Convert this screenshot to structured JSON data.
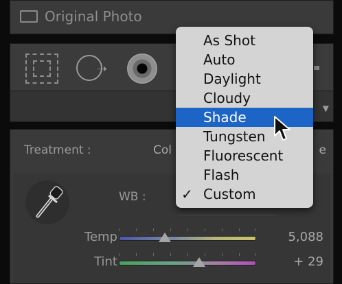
{
  "original_photo": {
    "label": "Original Photo"
  },
  "tools": {
    "icons": [
      "crop-overlay-icon",
      "spot-removal-icon",
      "red-eye-icon"
    ]
  },
  "basic": {
    "treatment_label": "Treatment :",
    "treatment_color": "Col",
    "treatment_bw": "e",
    "wb_label": "WB :",
    "temp": {
      "label": "Temp",
      "value": "5,088",
      "fraction": 0.34
    },
    "tint": {
      "label": "Tint",
      "value": "+ 29",
      "fraction": 0.59
    }
  },
  "wb_menu": {
    "items": [
      {
        "label": "As Shot",
        "checked": false,
        "selected": false
      },
      {
        "label": "Auto",
        "checked": false,
        "selected": false
      },
      {
        "label": "Daylight",
        "checked": false,
        "selected": false
      },
      {
        "label": "Cloudy",
        "checked": false,
        "selected": false
      },
      {
        "label": "Shade",
        "checked": false,
        "selected": true
      },
      {
        "label": "Tungsten",
        "checked": false,
        "selected": false
      },
      {
        "label": "Fluorescent",
        "checked": false,
        "selected": false
      },
      {
        "label": "Flash",
        "checked": false,
        "selected": false
      },
      {
        "label": "Custom",
        "checked": true,
        "selected": false
      }
    ],
    "check_glyph": "✓"
  },
  "colors": {
    "menu_bg": "#d4d4d4",
    "menu_selected": "#1d64c7",
    "panel_bg": "#3a3a3a"
  }
}
